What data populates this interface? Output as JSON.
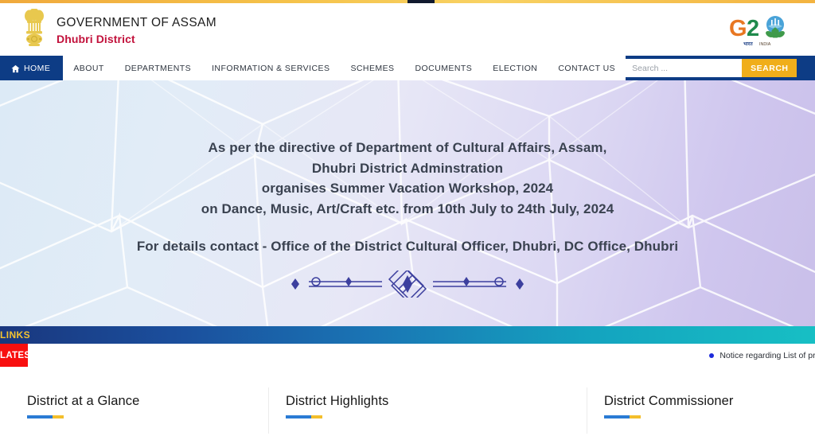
{
  "header": {
    "emblem_icon": "ashoka-lion-capital-emblem",
    "title": "GOVERNMENT OF ASSAM",
    "subtitle": "Dhubri District",
    "g20_logo_text": "G20",
    "g20_tagline": "भारत | INDIA"
  },
  "nav": {
    "items": [
      {
        "label": "HOME",
        "icon": "home-icon",
        "active": true
      },
      {
        "label": "ABOUT",
        "active": false
      },
      {
        "label": "DEPARTMENTS",
        "active": false
      },
      {
        "label": "INFORMATION & SERVICES",
        "active": false
      },
      {
        "label": "SCHEMES",
        "active": false
      },
      {
        "label": "DOCUMENTS",
        "active": false
      },
      {
        "label": "ELECTION",
        "active": false
      },
      {
        "label": "CONTACT US",
        "active": false
      }
    ],
    "search": {
      "placeholder": "Search ...",
      "value": "",
      "button_label": "SEARCH"
    }
  },
  "hero": {
    "lines": [
      "As per the directive of Department of Cultural Affairs, Assam,",
      "Dhubri District Adminstration",
      "organises  Summer Vacation Workshop, 2024",
      "on Dance, Music, Art/Craft etc. from 10th July to 24th July, 2024"
    ],
    "contact": "For details contact - Office of the District Cultural Officer, Dhubri, DC Office, Dhubri",
    "ornament_icon": "decorative-divider-ornament"
  },
  "links_bar": {
    "label": "LINKS"
  },
  "latest": {
    "tag": "LATEST",
    "items": [
      {
        "text": "Notice regarding List of provi"
      }
    ]
  },
  "panels": [
    {
      "title": "District at a Glance"
    },
    {
      "title": "District Highlights"
    },
    {
      "title": "District Commissioner"
    }
  ],
  "colors": {
    "nav_blue": "#0d3c85",
    "search_button": "#f0ae1b",
    "brand_red": "#c2113b",
    "latest_red": "#f80f0f",
    "links_label_gold": "#f4c430",
    "accent_blue": "#2a7bd4",
    "accent_gold": "#f3bf2c"
  }
}
